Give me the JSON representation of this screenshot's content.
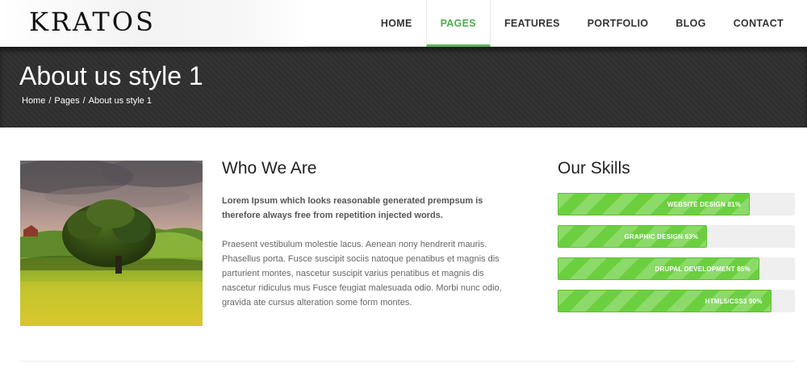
{
  "brand": {
    "logo_text": "KRATOS"
  },
  "nav": {
    "items": [
      {
        "label": "HOME",
        "active": false
      },
      {
        "label": "PAGES",
        "active": true
      },
      {
        "label": "FEATURES",
        "active": false
      },
      {
        "label": "PORTFOLIO",
        "active": false
      },
      {
        "label": "BLOG",
        "active": false
      },
      {
        "label": "CONTACT",
        "active": false
      }
    ]
  },
  "title_band": {
    "title": "About us style 1",
    "breadcrumb": [
      "Home",
      "Pages",
      "About us style 1"
    ],
    "separator": "/"
  },
  "who_we_are": {
    "heading": "Who We Are",
    "lead": "Lorem Ipsum which looks reasonable generated prempsum is therefore always free from repetition injected words.",
    "body": "Praesent vestibulum molestie lacus. Aenean nony hendrerit mauris. Phasellus porta. Fusce suscipit sociis natoque penatibus et magnis dis parturient montes, nascetur suscipit varius penatibus et magnis dis nascetur ridiculus mus Fusce feugiat malesuada odio. Morbi nunc odio, gravida ate cursus alteration some form montes."
  },
  "skills": {
    "heading": "Our Skills",
    "items": [
      {
        "label": "WEBSITE DESIGN 81%",
        "percent": 81
      },
      {
        "label": "GRAPHIC DESIGN 63%",
        "percent": 63
      },
      {
        "label": "DRUPAL DEVELOPMENT 85%",
        "percent": 85
      },
      {
        "label": "HTML5/CSS3 90%",
        "percent": 90
      }
    ]
  },
  "colors": {
    "accent": "#5cb85c",
    "bar": "#6ccf3f",
    "band": "#2e2e2e"
  }
}
